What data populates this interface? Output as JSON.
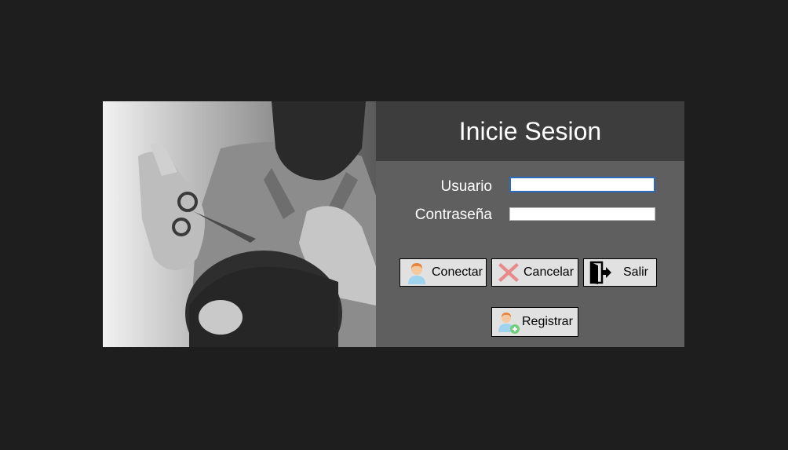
{
  "login": {
    "title": "Inicie Sesion",
    "user_label": "Usuario",
    "password_label": "Contraseña",
    "user_value": "",
    "password_value": ""
  },
  "buttons": {
    "connect": {
      "label": "Conectar",
      "icon": "user-icon"
    },
    "cancel": {
      "label": "Cancelar",
      "icon": "x-icon"
    },
    "exit": {
      "label": "Salir",
      "icon": "door-exit-icon"
    },
    "register": {
      "label": "Registrar",
      "icon": "user-add-icon"
    }
  },
  "colors": {
    "background": "#1e1e1e",
    "header": "#3d3d3d",
    "form": "#5f5f5f",
    "focus_border": "#2a6bbd"
  }
}
